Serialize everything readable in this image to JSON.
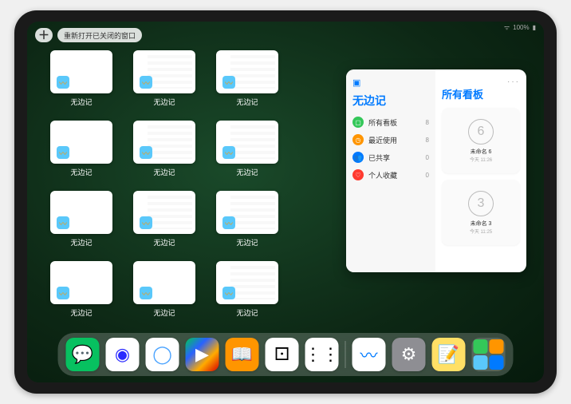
{
  "status": {
    "wifi": "ᯤ",
    "battery": "100%"
  },
  "top": {
    "plus": "＋",
    "reopen_label": "重新打开已关闭的窗口"
  },
  "app_name": "无边记",
  "windows": [
    {
      "label": "无边记",
      "blank": true
    },
    {
      "label": "无边记",
      "blank": false
    },
    {
      "label": "无边记",
      "blank": false
    },
    {
      "label": "无边记",
      "blank": true
    },
    {
      "label": "无边记",
      "blank": false
    },
    {
      "label": "无边记",
      "blank": false
    },
    {
      "label": "无边记",
      "blank": true
    },
    {
      "label": "无边记",
      "blank": false
    },
    {
      "label": "无边记",
      "blank": false
    },
    {
      "label": "无边记",
      "blank": true
    },
    {
      "label": "无边记",
      "blank": true
    },
    {
      "label": "无边记",
      "blank": false
    }
  ],
  "panel": {
    "title": "无边记",
    "boards_title": "所有看板",
    "menu_icon": "···",
    "items": [
      {
        "icon_color": "#34c759",
        "glyph": "▢",
        "label": "所有看板",
        "count": "8"
      },
      {
        "icon_color": "#ff9500",
        "glyph": "◷",
        "label": "最近使用",
        "count": "8"
      },
      {
        "icon_color": "#007aff",
        "glyph": "👥",
        "label": "已共享",
        "count": "0"
      },
      {
        "icon_color": "#ff3b30",
        "glyph": "♡",
        "label": "个人收藏",
        "count": "0"
      }
    ],
    "boards": [
      {
        "sketch": "6",
        "name": "未命名 6",
        "date": "今天 11:26"
      },
      {
        "sketch": "3",
        "name": "未命名 3",
        "date": "今天 11:25"
      }
    ]
  },
  "dock": {
    "apps": [
      {
        "name": "wechat",
        "bg": "#07c160",
        "glyph": "💬"
      },
      {
        "name": "quark-hd",
        "bg": "#ffffff",
        "glyph": "◉"
      },
      {
        "name": "quark",
        "bg": "#ffffff",
        "glyph": "◯"
      },
      {
        "name": "play",
        "bg": "#ffffff",
        "glyph": "▶"
      },
      {
        "name": "books",
        "bg": "#ff9500",
        "glyph": "📖"
      },
      {
        "name": "dice",
        "bg": "#ffffff",
        "glyph": "⚀"
      },
      {
        "name": "dots",
        "bg": "#ffffff",
        "glyph": "⋮⋮"
      },
      {
        "name": "freeform",
        "bg": "#ffffff",
        "glyph": "〰"
      },
      {
        "name": "settings",
        "bg": "#8e8e93",
        "glyph": "⚙"
      },
      {
        "name": "notes",
        "bg": "#ffe066",
        "glyph": "📝"
      }
    ],
    "recent": {
      "colors": [
        "#34c759",
        "#ff9500",
        "#5ac8fa",
        "#007aff"
      ]
    }
  },
  "colors": {
    "accent": "#007aff"
  }
}
